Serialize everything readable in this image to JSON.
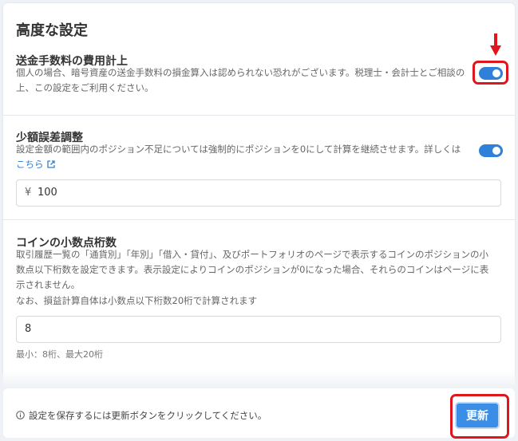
{
  "card_title": "高度な設定",
  "fee_expense": {
    "title": "送金手数料の費用計上",
    "description": "個人の場合、暗号資産の送金手数料の損金算入は認められない恐れがございます。税理士・会計士とご相談の上、この設定をご利用ください。",
    "toggle_on": true
  },
  "small_diff": {
    "title": "少額誤差調整",
    "description": "設定金額の範囲内のポジション不足については強制的にポジションを0にして計算を継続させます。詳しくは",
    "link_text": "こちら",
    "toggle_on": true,
    "currency_symbol": "¥",
    "amount": "100"
  },
  "decimal_digits": {
    "title": "コインの小数点桁数",
    "description": "取引履歴一覧の「通貨別」「年別」「借入・貸付」、及びポートフォリオのページで表示するコインのポジションの小数点以下桁数を設定できます。表示設定によりコインのポジションが0になった場合、それらのコインはページに表示されません。",
    "note": "なお、損益計算自体は小数点以下桁数20桁で計算されます",
    "value": "8",
    "range_hint": "最小：8桁、最大20桁"
  },
  "footer": {
    "message": "設定を保存するには更新ボタンをクリックしてください。",
    "update_label": "更新"
  },
  "colors": {
    "accent": "#2f80d8",
    "highlight": "#e0161e",
    "button": "#3a8ee6"
  }
}
